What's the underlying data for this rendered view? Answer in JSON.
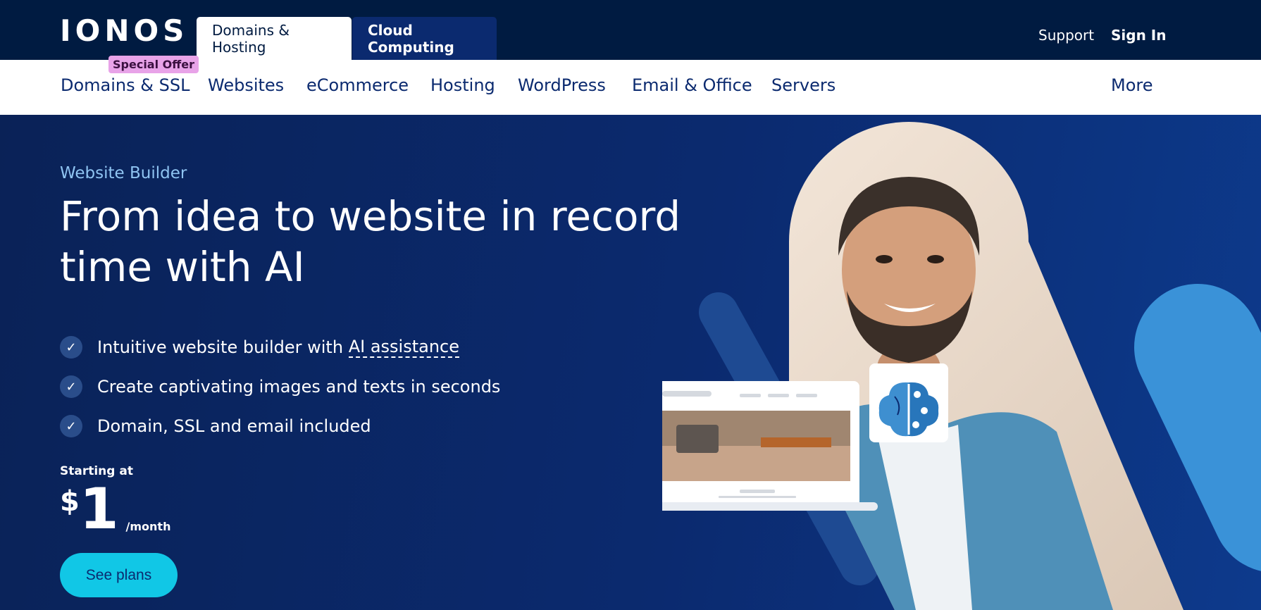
{
  "brand": {
    "logo_text": "IONOS"
  },
  "top_tabs": [
    {
      "label": "Domains & Hosting",
      "active": true
    },
    {
      "label": "Cloud Computing",
      "active": false
    }
  ],
  "top_links": {
    "support": "Support",
    "sign_in": "Sign In"
  },
  "nav": {
    "badge": "Special Offer",
    "items": [
      "Domains & SSL",
      "Websites",
      "eCommerce",
      "Hosting",
      "WordPress",
      "Email & Office",
      "Servers"
    ],
    "more": "More"
  },
  "hero": {
    "eyebrow": "Website Builder",
    "headline": "From idea to website in record time with AI",
    "features": [
      {
        "text": "Intuitive website builder with ",
        "link": "AI assistance"
      },
      {
        "text": "Create captivating images and texts in seconds"
      },
      {
        "text": "Domain, SSL and email included"
      }
    ],
    "starting_label": "Starting at",
    "currency": "$",
    "price": "1",
    "period": "/month",
    "cta": "See plans"
  },
  "colors": {
    "topbar": "#001b41",
    "hero": "#0b2a6f",
    "accent": "#11c7e6",
    "badge": "#e8a3e8"
  },
  "icons": [
    "check-icon",
    "ai-brain-icon",
    "laptop-mockup"
  ]
}
